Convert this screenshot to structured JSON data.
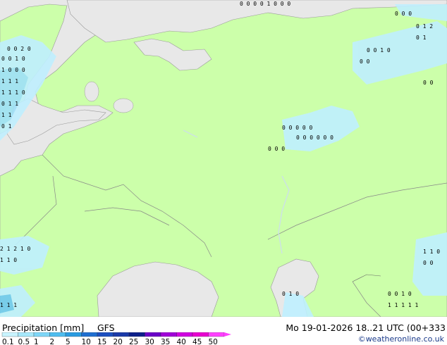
{
  "legend": {
    "title": "Precipitation [mm]",
    "model": "GFS",
    "valid_time": "Mo 19-01-2026 18..21 UTC (00+333",
    "credit": "©weatheronline.co.uk",
    "scale_labels": [
      "0.1",
      "0.5",
      "1",
      "2",
      "5",
      "10",
      "15",
      "20",
      "25",
      "30",
      "35",
      "40",
      "45",
      "50"
    ],
    "scale_colors": [
      "#c8f4ff",
      "#a6e8fb",
      "#7ed6f7",
      "#4fbdef",
      "#2a9be0",
      "#1f6fd0",
      "#1c4fc0",
      "#1a3aa8",
      "#0d1f8a",
      "#6a00c8",
      "#a000d8",
      "#d000e0",
      "#e800d0",
      "#ff40ff"
    ]
  }
}
